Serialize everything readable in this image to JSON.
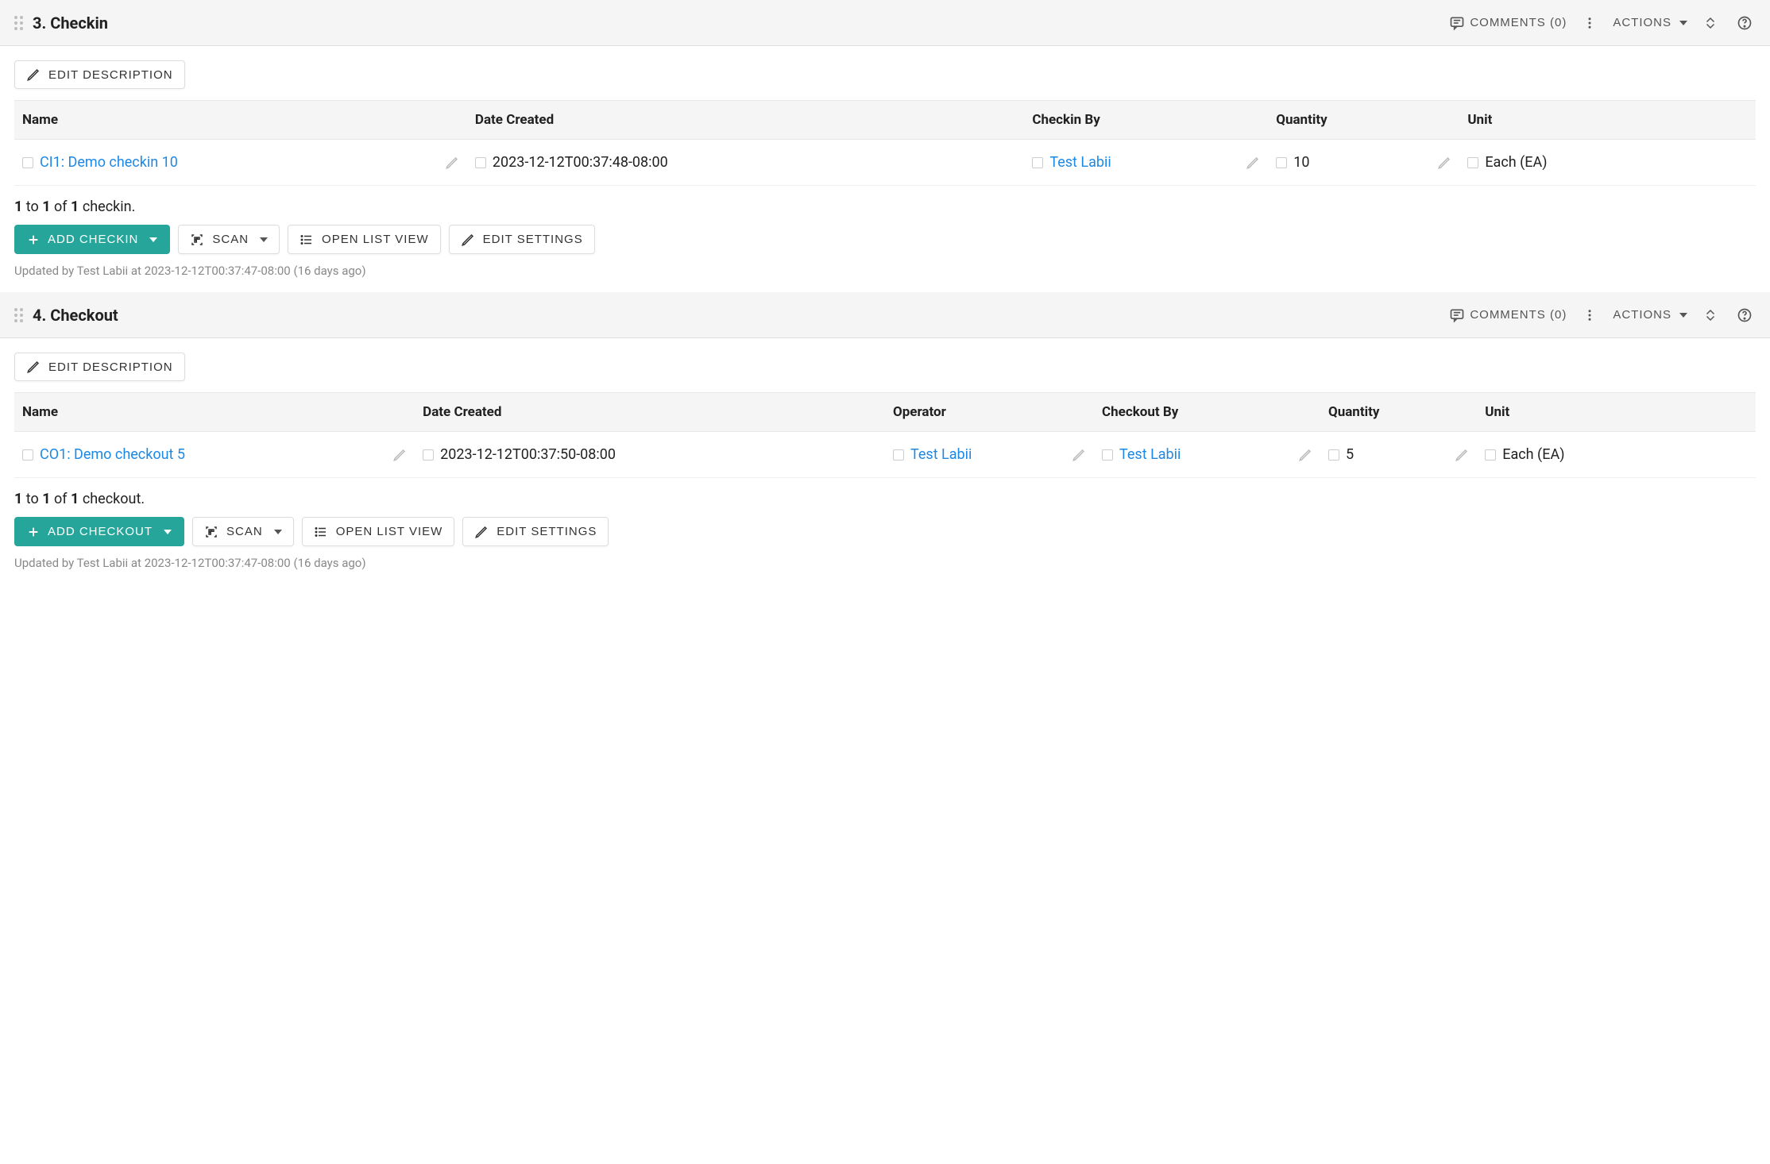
{
  "sections": [
    {
      "title": "3. Checkin",
      "comments_label": "COMMENTS (0)",
      "actions_label": "ACTIONS",
      "edit_description_label": "EDIT DESCRIPTION",
      "columns": [
        "Name",
        "Date Created",
        "Checkin By",
        "Quantity",
        "Unit"
      ],
      "row": {
        "name": "CI1: Demo checkin 10",
        "date_created": "2023-12-12T00:37:48-08:00",
        "by": "Test Labii",
        "quantity": "10",
        "unit": "Each (EA)"
      },
      "count_parts": {
        "from": "1",
        "to_word": " to ",
        "to": "1",
        "of_word": " of ",
        "total": "1",
        "suffix": " checkin."
      },
      "buttons": {
        "add": "ADD CHECKIN",
        "scan": "SCAN",
        "open_list": "OPEN LIST VIEW",
        "edit_settings": "EDIT SETTINGS"
      },
      "updated": "Updated by Test Labii at 2023-12-12T00:37:47-08:00 (16 days ago)"
    },
    {
      "title": "4. Checkout",
      "comments_label": "COMMENTS (0)",
      "actions_label": "ACTIONS",
      "edit_description_label": "EDIT DESCRIPTION",
      "columns": [
        "Name",
        "Date Created",
        "Operator",
        "Checkout By",
        "Quantity",
        "Unit"
      ],
      "row": {
        "name": "CO1: Demo checkout 5",
        "date_created": "2023-12-12T00:37:50-08:00",
        "operator": "Test Labii",
        "by": "Test Labii",
        "quantity": "5",
        "unit": "Each (EA)"
      },
      "count_parts": {
        "from": "1",
        "to_word": " to ",
        "to": "1",
        "of_word": " of ",
        "total": "1",
        "suffix": " checkout."
      },
      "buttons": {
        "add": "ADD CHECKOUT",
        "scan": "SCAN",
        "open_list": "OPEN LIST VIEW",
        "edit_settings": "EDIT SETTINGS"
      },
      "updated": "Updated by Test Labii at 2023-12-12T00:37:47-08:00 (16 days ago)"
    }
  ]
}
